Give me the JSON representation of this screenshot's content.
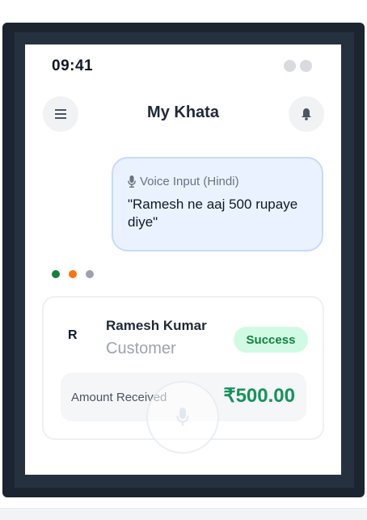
{
  "status_bar": {
    "time": "09:41"
  },
  "header": {
    "title": "My Khata",
    "menu_icon": "menu-icon",
    "bell_icon": "bell-icon"
  },
  "voice_bubble": {
    "label": "Voice Input (Hindi)",
    "text": "\"Ramesh ne aaj 500 rupaye diye\"",
    "icon": "microphone-icon"
  },
  "typing_indicator": {
    "colors": [
      "#15803d",
      "#f97316",
      "#9ca3af"
    ]
  },
  "transaction_card": {
    "avatar_initial": "R",
    "name": "Ramesh Kumar",
    "role": "Customer",
    "status": "Success",
    "amount_label": "Amount Received",
    "amount": "₹500.00"
  },
  "colors": {
    "accent_green": "#15935a",
    "bubble_bg": "#eaf2ff",
    "badge_bg": "#d1fae5"
  }
}
